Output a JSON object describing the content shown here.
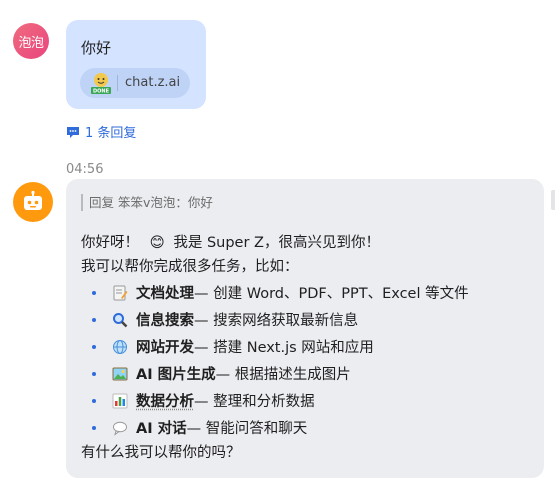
{
  "user_message": {
    "avatar_text": "泡泡",
    "text": "你好",
    "link_card": {
      "domain": "chat.z.ai",
      "icon": "done-dog-icon"
    },
    "reply_count": "1 条回复"
  },
  "bot_message": {
    "timestamp": "04:56",
    "avatar_icon": "robot-icon",
    "quote": "回复 笨笨v泡泡：你好",
    "greeting": "你好呀！",
    "smile": "😊",
    "intro": "我是 Super Z，很高兴见到你！",
    "lead": "我可以帮你完成很多任务，比如：",
    "items": [
      {
        "icon": "memo-icon",
        "title": "文档处理",
        "desc": " — 创建 Word、PDF、PPT、Excel 等文件"
      },
      {
        "icon": "magnifier-icon",
        "title": "信息搜索",
        "desc": " — 搜索网络获取最新信息"
      },
      {
        "icon": "globe-icon",
        "title": "网站开发",
        "desc": " — 搭建 Next.js 网站和应用"
      },
      {
        "icon": "picture-icon",
        "title": "AI 图片生成",
        "desc": " — 根据描述生成图片"
      },
      {
        "icon": "bar-chart-icon",
        "title": "数据分析",
        "desc": " — 整理和分析数据"
      },
      {
        "icon": "speech-bubble-icon",
        "title": "AI 对话",
        "desc": " — 智能问答和聊天"
      }
    ],
    "closing": "有什么我可以帮你的吗？"
  }
}
